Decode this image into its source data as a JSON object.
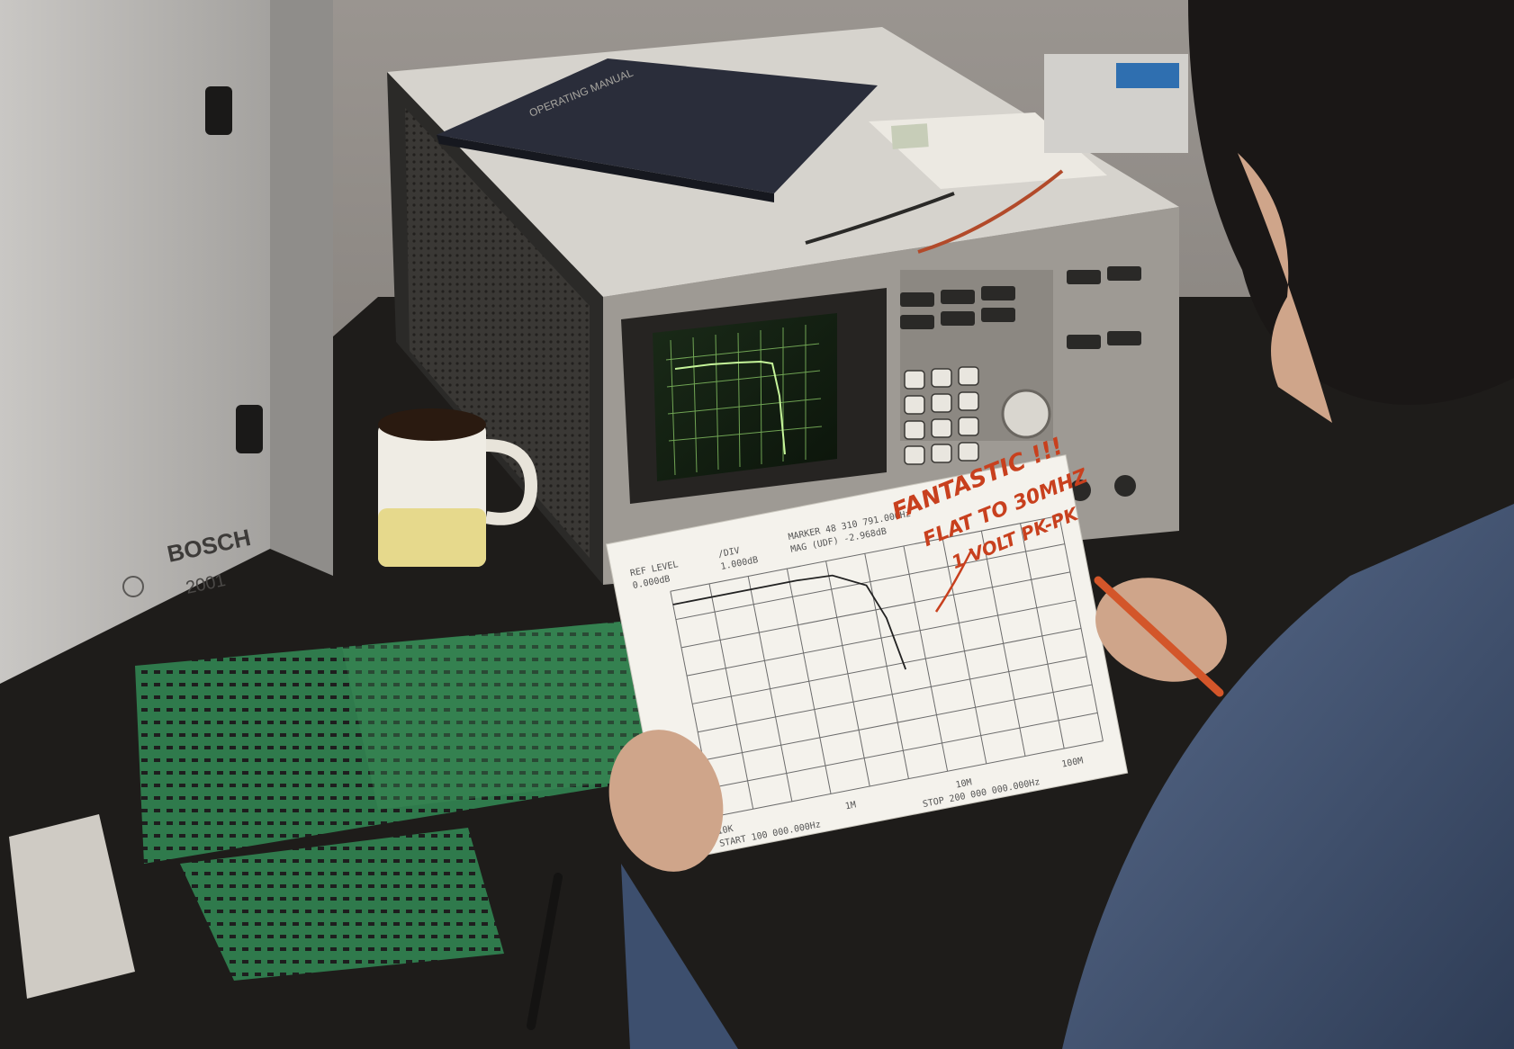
{
  "colors": {
    "wall": "#8a8580",
    "desk": "#1e1c1a",
    "cabinet": "#b8b6b3",
    "analyzer_top": "#d6d3cd",
    "analyzer_front": "#9e9a94",
    "crt_glow": "#8fd06a",
    "pcb_green": "#2f7a4c",
    "mug_yellow": "#e6d98c",
    "paper": "#f4f2ec",
    "plot_grid": "#6b6b6b",
    "handwriting": "#c8401e",
    "sweater": "#3d4f6e",
    "hair": "#1a1716",
    "skin": "#cfa58a",
    "pen": "#d3562a"
  },
  "cabinet": {
    "brand": "BOSCH",
    "model": "2001"
  },
  "printout": {
    "header_left_top": "REF LEVEL",
    "header_left_bottom": "0.000dB",
    "header_mid_top": "/DIV",
    "header_mid_bottom": "1.000dB",
    "header_right_top": "MARKER 48 310 791.000Hz",
    "header_right_bottom": "MAG (UDF)   -2.968dB",
    "x_tick_1": "10K",
    "x_tick_2": "1M",
    "x_tick_3": "10M",
    "x_tick_4": "100M",
    "start_label": "START 100 000.000Hz",
    "stop_label": "STOP 200 000 000.000Hz"
  },
  "handwritten_note": {
    "line1": "FANTASTIC !!!",
    "line2": "FLAT TO 30MHZ",
    "line3": "1 VOLT PK-PK"
  },
  "binder": {
    "spine_text": "OPERATING MANUAL"
  }
}
